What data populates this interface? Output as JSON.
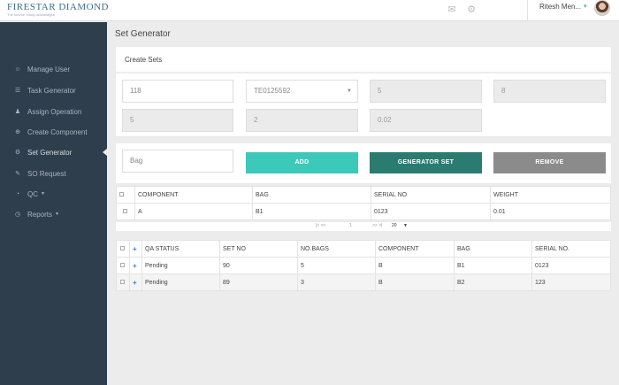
{
  "header": {
    "logo": "FIRESTAR DIAMOND",
    "tagline": "The source. Many advantages.",
    "user": "Ritesh Men..."
  },
  "icons": {
    "mail": "mail-icon",
    "settings": "gear-icon"
  },
  "sidebar": {
    "items": [
      {
        "label": "Manage User",
        "icon": "user-manage-icon"
      },
      {
        "label": "Task Generator",
        "icon": "task-icon"
      },
      {
        "label": "Assign Operation",
        "icon": "assign-icon"
      },
      {
        "label": "Create Component",
        "icon": "plus-circle-icon"
      },
      {
        "label": "Set Generator",
        "icon": "gear-icon"
      },
      {
        "label": "SO Request",
        "icon": "request-icon"
      },
      {
        "label": "QC",
        "icon": "qc-icon"
      },
      {
        "label": "Reports",
        "icon": "reports-icon"
      }
    ]
  },
  "page": {
    "title": "Set Generator",
    "section": "Create Sets"
  },
  "form": {
    "row1": [
      "118",
      "TE0125592",
      "5",
      "8"
    ],
    "row2": [
      "5",
      "2",
      "0.02"
    ],
    "bag_placeholder": "Bag"
  },
  "buttons": {
    "add": "ADD",
    "generator_set": "GENERATOR SET",
    "remove": "REMOVE"
  },
  "colors": {
    "add": "#3cc9ba",
    "generator": "#2a7b70",
    "remove": "#8b8b8b"
  },
  "component_table": {
    "headers": [
      "COMPONENT",
      "BAG",
      "SERIAL NO",
      "WEIGHT"
    ],
    "rows": [
      [
        "A",
        "B1",
        "0123",
        "0.01"
      ]
    ]
  },
  "pager": {
    "nav_left": "|<  <<",
    "page": "1",
    "nav_right": ">>  >|",
    "page_size": "20"
  },
  "qa_table": {
    "headers": [
      "QA STATUS",
      "SET NO",
      "NO.BAGS",
      "COMPONENT",
      "BAG",
      "SERIAL NO."
    ],
    "rows": [
      [
        "Pending",
        "90",
        "5",
        "B",
        "B1",
        "0123"
      ],
      [
        "Pending",
        "89",
        "3",
        "B",
        "B2",
        "123"
      ]
    ]
  }
}
